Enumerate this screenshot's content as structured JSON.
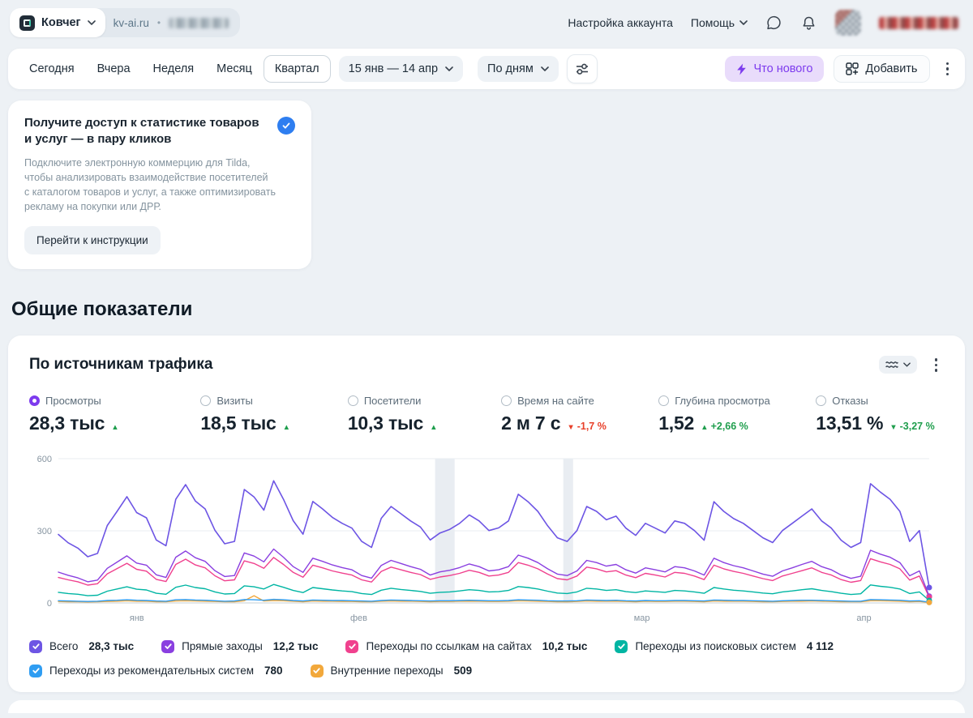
{
  "header": {
    "counter_name": "Ковчег",
    "site": "kv-ai.ru",
    "separator": "•",
    "account_settings": "Настройка аккаунта",
    "help": "Помощь"
  },
  "toolbar": {
    "tabs": [
      {
        "label": "Сегодня",
        "state": "plain"
      },
      {
        "label": "Вчера",
        "state": "plain"
      },
      {
        "label": "Неделя",
        "state": "plain"
      },
      {
        "label": "Месяц",
        "state": "plain"
      },
      {
        "label": "Квартал",
        "state": "active"
      }
    ],
    "date_range": "15 янв — 14 апр",
    "granularity": "По дням",
    "whats_new": "Что нового",
    "add": "Добавить"
  },
  "promo": {
    "title": "Получите доступ к статистике товаров и услуг — в пару кликов",
    "body": "Подключите электронную коммерцию для Tilda, чтобы анализировать взаимодействие посетителей с каталогом товаров и услуг, а также оптимизировать рекламу на покупки или ДРР.",
    "cta": "Перейти к инструкции"
  },
  "section_title": "Общие показатели",
  "chart_card": {
    "title": "По источникам трафика",
    "metrics": [
      {
        "label": "Просмотры",
        "value": "28,3 тыс",
        "arrow": "▲",
        "pct": "",
        "tone": "green",
        "radio": "selected"
      },
      {
        "label": "Визиты",
        "value": "18,5 тыс",
        "arrow": "▲",
        "pct": "",
        "tone": "green",
        "radio": "unselected"
      },
      {
        "label": "Посетители",
        "value": "10,3 тыс",
        "arrow": "▲",
        "pct": "",
        "tone": "green",
        "radio": "unselected"
      },
      {
        "label": "Время на сайте",
        "value": "2 м 7 с",
        "arrow": "▼",
        "pct": "-1,7 %",
        "tone": "red",
        "radio": "unselected"
      },
      {
        "label": "Глубина просмотра",
        "value": "1,52",
        "arrow": "▲",
        "pct": "+2,66 %",
        "tone": "green",
        "radio": "unselected"
      },
      {
        "label": "Отказы",
        "value": "13,51 %",
        "arrow": "▼",
        "pct": "-3,27 %",
        "tone": "green",
        "radio": "unselected"
      }
    ]
  },
  "colors": {
    "accent_purple": "#7d3bee",
    "green": "#1f9e4d",
    "red": "#e8402a"
  },
  "chart_data": {
    "type": "line",
    "title": "По источникам трафика",
    "x_unit": "day",
    "x_range": "15 янв — 14 апр",
    "ylim": [
      0,
      600
    ],
    "yticks": [
      0,
      300,
      600
    ],
    "grid": "horizontal",
    "legend_position": "bottom",
    "month_labels": [
      {
        "label": "янв",
        "frac": 0.09
      },
      {
        "label": "фев",
        "frac": 0.345
      },
      {
        "label": "мар",
        "frac": 0.67
      },
      {
        "label": "апр",
        "frac": 0.925
      }
    ],
    "holiday_bands": [
      {
        "from_day": 38.5,
        "to_day": 40.5
      },
      {
        "from_day": 51.6,
        "to_day": 52.6
      }
    ],
    "series": [
      {
        "name": "Всего",
        "total": "28,3 тыс",
        "color": "#6d55e4",
        "values": [
          285,
          250,
          228,
          192,
          206,
          322,
          381,
          442,
          376,
          354,
          262,
          238,
          431,
          492,
          424,
          391,
          302,
          246,
          256,
          472,
          441,
          386,
          508,
          431,
          342,
          286,
          422,
          391,
          356,
          331,
          311,
          256,
          231,
          352,
          401,
          371,
          341,
          316,
          262,
          291,
          306,
          331,
          366,
          341,
          301,
          312,
          341,
          452,
          421,
          381,
          321,
          271,
          256,
          301,
          401,
          381,
          346,
          361,
          311,
          281,
          331,
          311,
          291,
          341,
          331,
          301,
          261,
          421,
          381,
          351,
          331,
          301,
          271,
          251,
          301,
          331,
          361,
          391,
          341,
          311,
          261,
          231,
          251,
          496,
          461,
          431,
          381,
          256,
          301,
          64
        ]
      },
      {
        "name": "Прямые заходы",
        "total": "12,2 тыс",
        "color": "#8a3fe0",
        "values": [
          128,
          115,
          104,
          88,
          95,
          144,
          170,
          196,
          166,
          157,
          117,
          106,
          190,
          216,
          188,
          173,
          134,
          110,
          114,
          208,
          195,
          171,
          224,
          190,
          151,
          127,
          186,
          173,
          158,
          147,
          138,
          114,
          103,
          156,
          177,
          164,
          151,
          140,
          116,
          129,
          136,
          147,
          162,
          151,
          133,
          138,
          151,
          199,
          186,
          168,
          142,
          120,
          114,
          133,
          177,
          168,
          153,
          160,
          138,
          124,
          146,
          138,
          129,
          151,
          146,
          133,
          116,
          186,
          168,
          155,
          146,
          133,
          120,
          111,
          133,
          146,
          160,
          173,
          151,
          138,
          116,
          102,
          111,
          219,
          203,
          190,
          168,
          113,
          133,
          28
        ]
      },
      {
        "name": "Переходы по ссылкам на сайтах",
        "total": "10,2 тыс",
        "color": "#f0418e",
        "values": [
          106,
          96,
          88,
          74,
          80,
          121,
          143,
          165,
          140,
          132,
          98,
          89,
          160,
          182,
          158,
          146,
          113,
          92,
          96,
          175,
          164,
          144,
          189,
          160,
          127,
          107,
          157,
          146,
          133,
          124,
          116,
          96,
          87,
          131,
          149,
          138,
          127,
          118,
          98,
          108,
          114,
          123,
          136,
          127,
          112,
          116,
          127,
          168,
          157,
          142,
          120,
          101,
          96,
          112,
          149,
          142,
          129,
          134,
          116,
          105,
          123,
          116,
          108,
          127,
          123,
          112,
          97,
          157,
          142,
          131,
          123,
          112,
          101,
          93,
          112,
          123,
          134,
          146,
          127,
          116,
          97,
          86,
          93,
          184,
          171,
          160,
          142,
          95,
          112,
          24
        ]
      },
      {
        "name": "Переходы из поисковых систем",
        "total": "4 112",
        "color": "#00b5a3",
        "values": [
          44,
          39,
          36,
          30,
          32,
          49,
          58,
          67,
          57,
          54,
          40,
          36,
          65,
          74,
          64,
          59,
          46,
          37,
          39,
          71,
          67,
          58,
          77,
          65,
          52,
          43,
          64,
          59,
          54,
          50,
          47,
          39,
          35,
          53,
          61,
          56,
          52,
          48,
          40,
          44,
          46,
          50,
          55,
          52,
          46,
          47,
          52,
          68,
          64,
          58,
          49,
          41,
          39,
          46,
          61,
          58,
          52,
          55,
          47,
          43,
          50,
          47,
          44,
          52,
          50,
          46,
          40,
          64,
          58,
          53,
          50,
          46,
          41,
          38,
          46,
          50,
          55,
          59,
          52,
          47,
          40,
          35,
          38,
          75,
          69,
          65,
          58,
          39,
          46,
          10
        ]
      },
      {
        "name": "Переходы из рекомендательных систем",
        "total": "780",
        "color": "#2f9df2",
        "values": [
          9,
          8,
          7,
          6,
          7,
          10,
          11,
          13,
          11,
          10,
          8,
          7,
          13,
          14,
          12,
          11,
          9,
          7,
          8,
          14,
          13,
          11,
          15,
          13,
          10,
          8,
          12,
          11,
          10,
          10,
          9,
          8,
          7,
          10,
          12,
          11,
          10,
          9,
          8,
          9,
          9,
          10,
          11,
          10,
          9,
          9,
          10,
          13,
          12,
          11,
          9,
          8,
          8,
          9,
          12,
          11,
          10,
          11,
          9,
          8,
          10,
          9,
          9,
          10,
          10,
          9,
          8,
          12,
          11,
          10,
          10,
          9,
          8,
          7,
          9,
          10,
          11,
          11,
          10,
          9,
          8,
          7,
          7,
          14,
          13,
          12,
          11,
          8,
          9,
          3
        ]
      },
      {
        "name": "Внутренние переходы",
        "total": "509",
        "color": "#f2a83b",
        "values": [
          6,
          5,
          5,
          4,
          5,
          6,
          7,
          9,
          7,
          7,
          5,
          5,
          8,
          9,
          8,
          7,
          6,
          5,
          5,
          9,
          30,
          8,
          10,
          9,
          7,
          5,
          8,
          7,
          7,
          6,
          6,
          5,
          5,
          7,
          8,
          7,
          7,
          6,
          5,
          6,
          6,
          7,
          7,
          7,
          6,
          6,
          7,
          9,
          8,
          7,
          6,
          5,
          5,
          6,
          8,
          7,
          7,
          7,
          6,
          5,
          7,
          6,
          6,
          7,
          7,
          6,
          5,
          8,
          7,
          7,
          7,
          6,
          5,
          5,
          6,
          7,
          7,
          8,
          7,
          6,
          5,
          5,
          5,
          9,
          9,
          8,
          7,
          5,
          6,
          2
        ]
      }
    ]
  }
}
